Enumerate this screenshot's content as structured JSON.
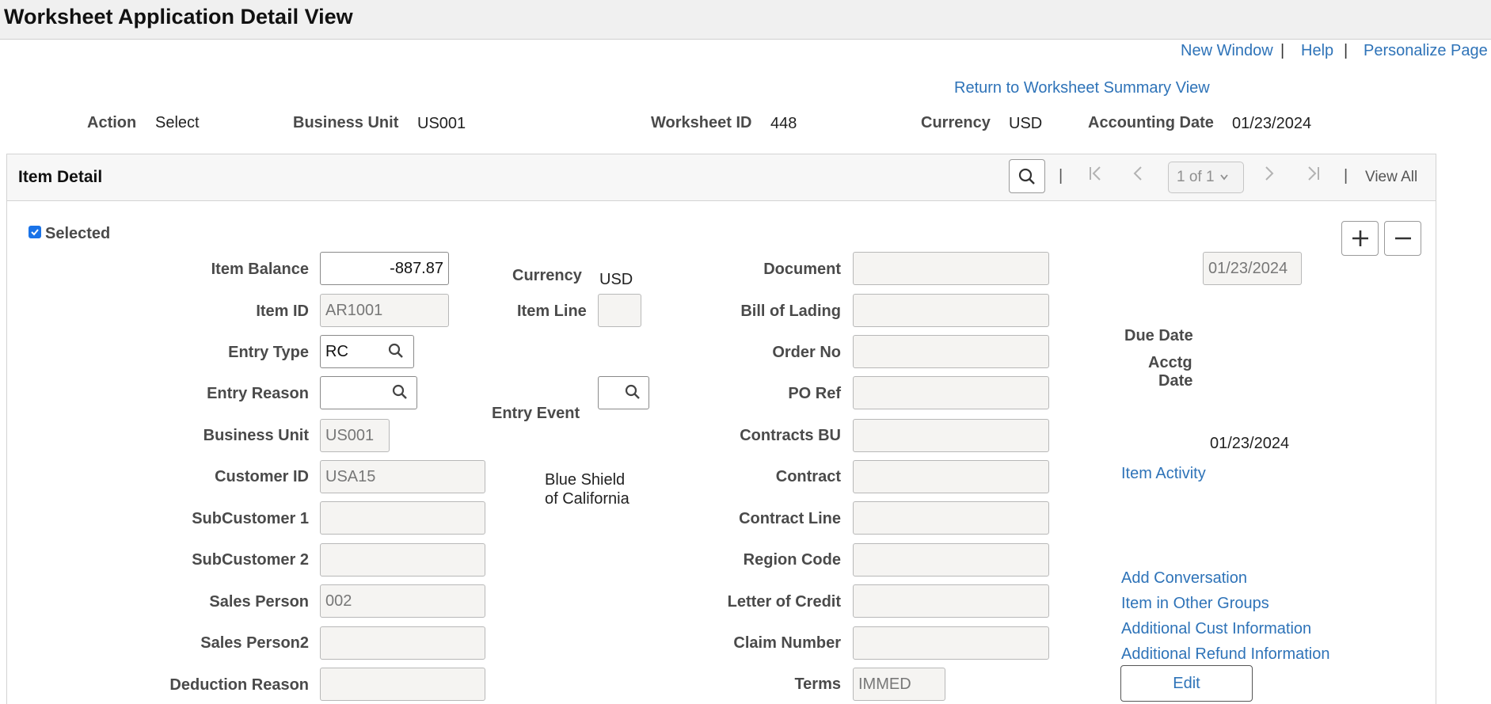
{
  "page": {
    "title": "Worksheet Application Detail View"
  },
  "top_links": {
    "new_window": "New Window",
    "help": "Help",
    "personalize": "Personalize Page",
    "separator": "|"
  },
  "return_link": "Return to Worksheet Summary View",
  "header": {
    "action_label": "Action",
    "action_value": "Select",
    "bu_label": "Business Unit",
    "bu_value": "US001",
    "worksheet_label": "Worksheet ID",
    "worksheet_value": "448",
    "currency_label": "Currency",
    "currency_value": "USD",
    "acctg_date_label": "Accounting Date",
    "acctg_date_value": "01/23/2024"
  },
  "section": {
    "title": "Item Detail",
    "pager": {
      "page_select": "1 of 1",
      "view_all": "View All",
      "separator": "|"
    }
  },
  "selected_label": "Selected",
  "left_fields": [
    {
      "label": "Item Balance",
      "value": "-887.87"
    },
    {
      "label": "Item ID",
      "value": "AR1001"
    },
    {
      "label": "Entry Type",
      "value": "RC"
    },
    {
      "label": "Entry Reason",
      "value": ""
    },
    {
      "label": "Business Unit",
      "value": "US001"
    },
    {
      "label": "Customer ID",
      "value": "USA15"
    },
    {
      "label": "SubCustomer 1",
      "value": ""
    },
    {
      "label": "SubCustomer 2",
      "value": ""
    },
    {
      "label": "Sales Person",
      "value": "002"
    },
    {
      "label": "Sales Person2",
      "value": ""
    },
    {
      "label": "Deduction Reason",
      "value": ""
    }
  ],
  "middle": {
    "currency_label": "Currency",
    "currency_value": "USD",
    "item_line_label": "Item Line",
    "item_line_value": "",
    "entry_event_label": "Entry Event",
    "entry_event_value": "",
    "customer_name_line1": "Blue Shield",
    "customer_name_line2": "of California"
  },
  "right_fields": [
    {
      "label": "Document",
      "value": ""
    },
    {
      "label": "Bill of Lading",
      "value": ""
    },
    {
      "label": "Order No",
      "value": ""
    },
    {
      "label": "PO Ref",
      "value": ""
    },
    {
      "label": "Contracts BU",
      "value": ""
    },
    {
      "label": "Contract",
      "value": ""
    },
    {
      "label": "Contract Line",
      "value": ""
    },
    {
      "label": "Region Code",
      "value": ""
    },
    {
      "label": "Letter of Credit",
      "value": ""
    },
    {
      "label": "Claim Number",
      "value": ""
    },
    {
      "label": "Terms",
      "value": "IMMED"
    }
  ],
  "far_right": {
    "due_date_value": "01/23/2024",
    "due_date_label": "Due Date",
    "acctg_date_label_1": "Acctg",
    "acctg_date_label_2": "Date",
    "acctg_date_value": "01/23/2024",
    "item_activity": "Item Activity",
    "add_conversation": "Add Conversation",
    "item_other_groups": "Item in Other Groups",
    "add_cust_info": "Additional Cust Information",
    "add_refund_info": "Additional Refund Information",
    "edit_button": "Edit"
  }
}
